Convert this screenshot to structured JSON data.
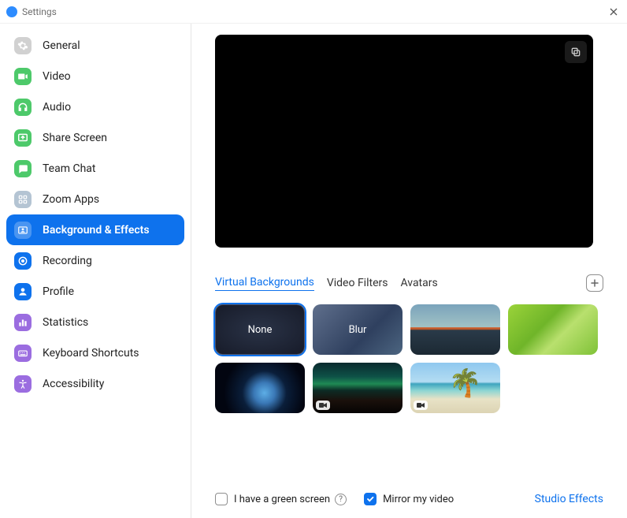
{
  "window": {
    "title": "Settings"
  },
  "sidebar": {
    "items": [
      {
        "label": "General"
      },
      {
        "label": "Video"
      },
      {
        "label": "Audio"
      },
      {
        "label": "Share Screen"
      },
      {
        "label": "Team Chat"
      },
      {
        "label": "Zoom Apps"
      },
      {
        "label": "Background & Effects"
      },
      {
        "label": "Recording"
      },
      {
        "label": "Profile"
      },
      {
        "label": "Statistics"
      },
      {
        "label": "Keyboard Shortcuts"
      },
      {
        "label": "Accessibility"
      }
    ]
  },
  "tabs": {
    "virtual_backgrounds": "Virtual Backgrounds",
    "video_filters": "Video Filters",
    "avatars": "Avatars"
  },
  "tiles": {
    "none": "None",
    "blur": "Blur"
  },
  "options": {
    "green_screen": "I have a green screen",
    "mirror": "Mirror my video",
    "studio_effects": "Studio Effects"
  }
}
